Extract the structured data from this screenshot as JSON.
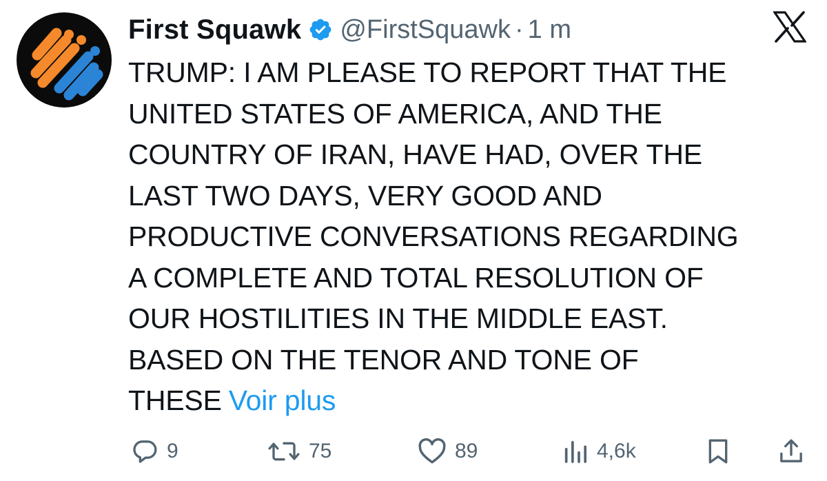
{
  "tweet": {
    "display_name": "First Squawk",
    "handle": "@FirstSquawk",
    "separator": "·",
    "time": "1 m",
    "body_lines": [
      "TRUMP: I AM PLEASE TO REPORT THAT THE",
      "UNITED STATES OF AMERICA, AND THE",
      "COUNTRY OF IRAN, HAVE HAD, OVER THE",
      "LAST TWO DAYS, VERY GOOD AND",
      "PRODUCTIVE CONVERSATIONS REGARDING",
      "A COMPLETE AND TOTAL RESOLUTION OF",
      "OUR HOSTILITIES IN THE MIDDLE EAST.",
      "BASED ON THE TENOR AND TONE OF",
      "THESE"
    ],
    "see_more_label": "Voir plus",
    "verified": true
  },
  "actions": {
    "replies": "9",
    "reposts": "75",
    "likes": "89",
    "views": "4,6k"
  },
  "icons": {
    "avatar": "first-squawk-logo",
    "verified": "verified-badge-icon",
    "platform": "x-logo-icon",
    "reply": "reply-icon",
    "repost": "repost-icon",
    "like": "heart-icon",
    "views": "views-icon",
    "bookmark": "bookmark-icon",
    "share": "share-icon"
  },
  "colors": {
    "text": "#0f1419",
    "secondary": "#536471",
    "link": "#1d9bf0",
    "verified": "#1d9bf0",
    "logo_orange": "#f5892b",
    "logo_blue": "#2b84d6",
    "avatar_bg": "#0b0b0b"
  }
}
